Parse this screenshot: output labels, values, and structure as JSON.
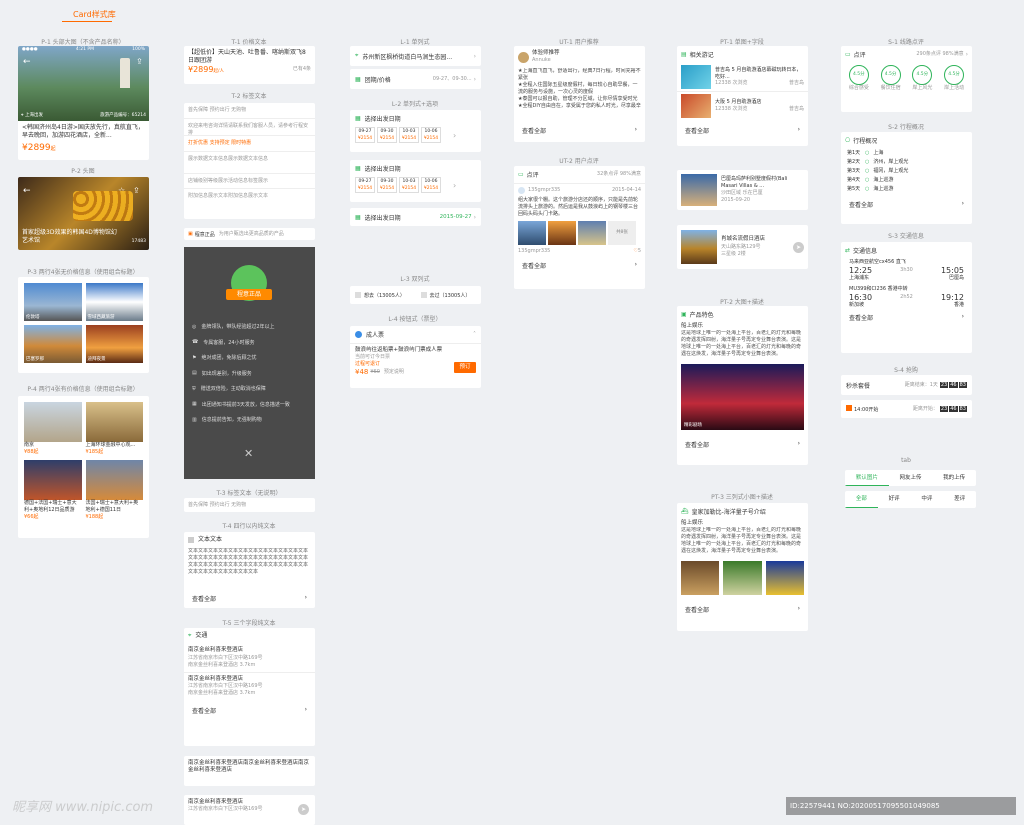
{
  "page_title": "Card样式库",
  "col1": {
    "p1_label": "P-1  头部大图（不含产品名称）",
    "p1_status_time": "4:21 PM",
    "p1_status_batt": "100%",
    "p1_location": "上海出发",
    "p1_tag": "旅游产品编号：65214",
    "p1_title": "<韩国济州岛4日游>国庆放先行，真航直飞，早去晚回，加游四花酒店，全新...",
    "p1_price": "¥2899",
    "p1_price_unit": "起",
    "p2_label": "P-2  头图",
    "p2_title": "首家超级3D效果的韩国4D博物馆幻艺术馆",
    "p2_count": "17483",
    "p3_label": "P-3  两行4张无价格信息（使用组合标题）",
    "p3_captions": [
      "伦敦塔",
      "雪域西藏旅游",
      "巴塞罗那",
      "迪拜夜景"
    ],
    "p4_label": "P-4  两行4张有价格信息（使用组合标题）",
    "p4_items": [
      {
        "name": "南京",
        "price": "¥88起"
      },
      {
        "name": "上海环球金融中心观...",
        "price": "¥185起"
      },
      {
        "name": "德国+法国+瑞士+意大利+奥地利12日品质游",
        "price": "¥66起"
      },
      {
        "name": "法国+瑞士+意大利+奥地利+德国11日",
        "price": "¥188起"
      }
    ]
  },
  "col2": {
    "t1_label": "T-1  价格文本",
    "t1_title": "【超低价】天山天池、吐鲁番、喀纳斯双飞8日跟团游",
    "t1_price": "¥2899",
    "t1_price_unit": "起/人",
    "t1_link": "已有4条",
    "t2_label": "T-2  标签文本",
    "t2_rows": [
      "首先保障  预约出行  无购物",
      "欢迎来电咨询详情请联系我们客服人员，请参考行程安排",
      "打折优惠  支持预定  限时特惠",
      "展示数据文本信息展示数据文本信息",
      "店铺级别等级展示活动信息标签展示",
      "附加信息展示文本附加信息展示文本"
    ],
    "guarantee_title": "程意正品",
    "guarantee_desc": "为用户甄选出更高品质的产品",
    "badge_text": "程意正品",
    "guarantee_items": [
      "金牌领队，带队经验超过2年以上",
      "专属客服，24小时服务",
      "绝对成团，免除后顾之忧",
      "如出现差别，升级服务",
      "赠送双倍险，主动取消也保障",
      "出团通知书提前3天发放，信息描述一致",
      "信息提前告知，无强制购物"
    ],
    "t3_label": "T-3  标签文本（无说明）",
    "t3_tags": "首先保障  预约出行  无购物",
    "t4_label": "T-4  四行以内纯文本",
    "t4_title": "文本文本",
    "t4_body": "文本文本文本文本文本文本文本文本文本文本文本文本文本文本文本文本文本文本文本文本文本文本文本文本文本文本文本文本文本文本文本文本文本文本文本文本文本文本文本文本文本文本文本",
    "t4_more": "查看全部",
    "t5_label": "T-5  三个字段纯文本",
    "t5_title": "交通",
    "t5_items": [
      {
        "name": "南京金丝利喜来登酒店",
        "addr": "江苏省南京市白下区汉中路169号",
        "meta": "南京金丝利喜来登酒店 3.7km"
      },
      {
        "name": "南京金丝利喜来登酒店",
        "addr": "江苏省南京市白下区汉中路169号",
        "meta": "南京金丝利喜来登酒店 3.7km"
      }
    ],
    "t5_more": "查看全部",
    "t6_text": "南京金丝利喜来登酒店南京金丝利喜来登酒店南京金丝利喜来登酒店",
    "t7_name": "南京金丝利喜来登酒店",
    "t7_addr": "江苏省南京市白下区汉中路169号"
  },
  "col3": {
    "l1_label": "L-1  单列式",
    "l1_location": "苏州新区枫桥街道白马涧生态园...",
    "l1_group": "团期/价格",
    "l1_dates": "09-27、09-30...",
    "l2_label": "L-2  单列式+选项",
    "l2_title": "选择出发日期",
    "l2_dates": [
      {
        "d": "09-27",
        "p": "¥2154"
      },
      {
        "d": "09-30",
        "p": "¥2154"
      },
      {
        "d": "10-03",
        "p": "¥2154"
      },
      {
        "d": "10-06",
        "p": "¥2154"
      }
    ],
    "l2_date_label": "选择出发日期",
    "l2_date_value": "2015-09-27",
    "l3_label": "L-3  双列式",
    "l3_a": "想去（13005人）",
    "l3_b": "去过（13005人）",
    "l4_label": "L-4  按钮式（票型）",
    "l4_head": "成人票",
    "l4_title": "鼓浪屿往返船票+鼓浪屿门票成人票",
    "l4_sub": "当前可订今日票",
    "l4_tag": "过程可退订",
    "l4_price": "¥48",
    "l4_orig": "¥60",
    "l4_note": "预定说明",
    "l4_btn": "预订"
  },
  "col4": {
    "ut1_label": "UT-1  用户推荐",
    "ut1_name": "体验师推荐",
    "ut1_user": "Annuke",
    "ut1_body": "★上海直飞直飞，舒适出行，经典7日行程，时间充裕不紧张\n★全程入住国际五星级度假村，每日较心自助早餐，一流的服务与设施，一次心灵的度假\n★泰国可以报自助，管理不分区域，让你尽情享受时光\n★全程DIY自由自在，享受属于您的私人时光，尽享最辛",
    "ut1_more": "查看全部",
    "ut2_label": "UT-2  用户点评",
    "ut2_title": "点评",
    "ut2_stats": "32条点评  98%满意",
    "ut2_user": "135gmpr335",
    "ut2_date": "2015-04-14",
    "ut2_body": "组大家很个棚。这个旅游分店还的顺序，只能是先前轮流排头上旅游的。然后运是我从鼓浪屿上的钢琴楼三台回码头码头门卡路。",
    "ut2_more_photos": "共8张",
    "ut2_foot": "135gmpr335",
    "ut2_likes": "5",
    "ut2_more": "查看全部",
    "pt1_label": "PT-1  单图+字段",
    "pt1_title": "相关游记",
    "pt1_items": [
      {
        "t": "普吉岛 5 月自助游酒店幕磁玩转日本，吃好...",
        "s": "12338 次浏览",
        "r": "普吉岛"
      },
      {
        "t": "大阪 5 月自助游酒店",
        "s": "12338 次浏览",
        "r": "普吉岛"
      }
    ],
    "pt1_more": "查看全部",
    "pt1b_items": [
      {
        "t": "巴厘岛玛萨利别墅度假村(Bali Masari Villas & ...",
        "s": "沙田区域  乐在巴厘",
        "d": "2015-09-20"
      },
      {
        "t": "肖城名流假日酒店",
        "s": "天山路东路129号",
        "d": "三星级  2楼"
      }
    ],
    "pt2_label": "PT-2  大图+描述",
    "pt2_title": "产品特色",
    "pt2_sub": "船上娱乐",
    "pt2_body": "这是地球上唯一的一处海上平台，百老汇的灯光和每晚的奇遇发挥四射，海洋量子号再定专业舞台表演。这是地球上唯一的一处海上平台，百老汇的灯光和每晚的奇遇在这焕发，海洋量子号再定专业舞台表演。",
    "pt2_caption": "精彩剧场",
    "pt2_more": "查看全部",
    "pt3_label": "PT-3  三列式小图+描述",
    "pt3_title": "皇家加勒比-海洋量子号介绍",
    "pt3_sub": "船上娱乐",
    "pt3_body": "这是地球上唯一的一处海上平台，百老汇的灯光和每晚的奇遇发挥四射，海洋量子号再定专业舞台表演。这是地球上唯一的一处海上平台，百老汇的灯光和每晚的奇遇在这焕发，海洋量子号再定专业舞台表演。",
    "pt3_more": "查看全部"
  },
  "col5": {
    "s1_label": "S-1  线路点评",
    "s1_title": "点评",
    "s1_stats": "290条点评  98%满意",
    "s1_scores": [
      {
        "v": "4.5分",
        "n": "综合感受"
      },
      {
        "v": "4.5分",
        "n": "餐饮住宿"
      },
      {
        "v": "4.5分",
        "n": "岸上风光"
      },
      {
        "v": "4.5分",
        "n": "岸上活动"
      }
    ],
    "s1_more": "查看全部",
    "s2_label": "S-2  行程概况",
    "s2_title": "行程概况",
    "s2_days": [
      {
        "d": "第1天",
        "p": "上海"
      },
      {
        "d": "第2天",
        "p": "济州，岸上观光"
      },
      {
        "d": "第3天",
        "p": "福冈，岸上观光"
      },
      {
        "d": "第4天",
        "p": "海上巡游"
      },
      {
        "d": "第5天",
        "p": "海上巡游"
      }
    ],
    "s2_more": "查看全部",
    "s3_label": "S-3  交通信息",
    "s3_title": "交通信息",
    "s3_f1": {
      "flight": "马来西亚航空cx456",
      "type": "直飞",
      "dep": "12:25",
      "arr": "15:05",
      "from": "上海浦东",
      "to": "巴厘岛",
      "dur": "3h30"
    },
    "s3_f2": {
      "flight": "MU399和CI236  香港中转",
      "dep": "16:30",
      "arr": "19:12",
      "from": "新加坡",
      "to": "香港",
      "dur": "2h52"
    },
    "s3_more": "查看全部",
    "s4_label": "S-4  抢购",
    "s4_a": "秒杀套餐",
    "s4_a_note": "距离结束：1天",
    "s4_a_time": [
      "23",
      "46",
      "83"
    ],
    "s4_b_tag": "14:00开始",
    "s4_b_note": "距离开始：",
    "s4_b_time": [
      "23",
      "46",
      "83"
    ],
    "tab_label": "tab",
    "tabs1": [
      "默认图片",
      "网友上传",
      "我的上传"
    ],
    "tabs2": [
      "全部",
      "好评",
      "中评",
      "差评"
    ]
  },
  "watermark_left": "昵享网 www.nipic.com",
  "watermark_right": "ID:22579441 NO:20200517095501049085"
}
